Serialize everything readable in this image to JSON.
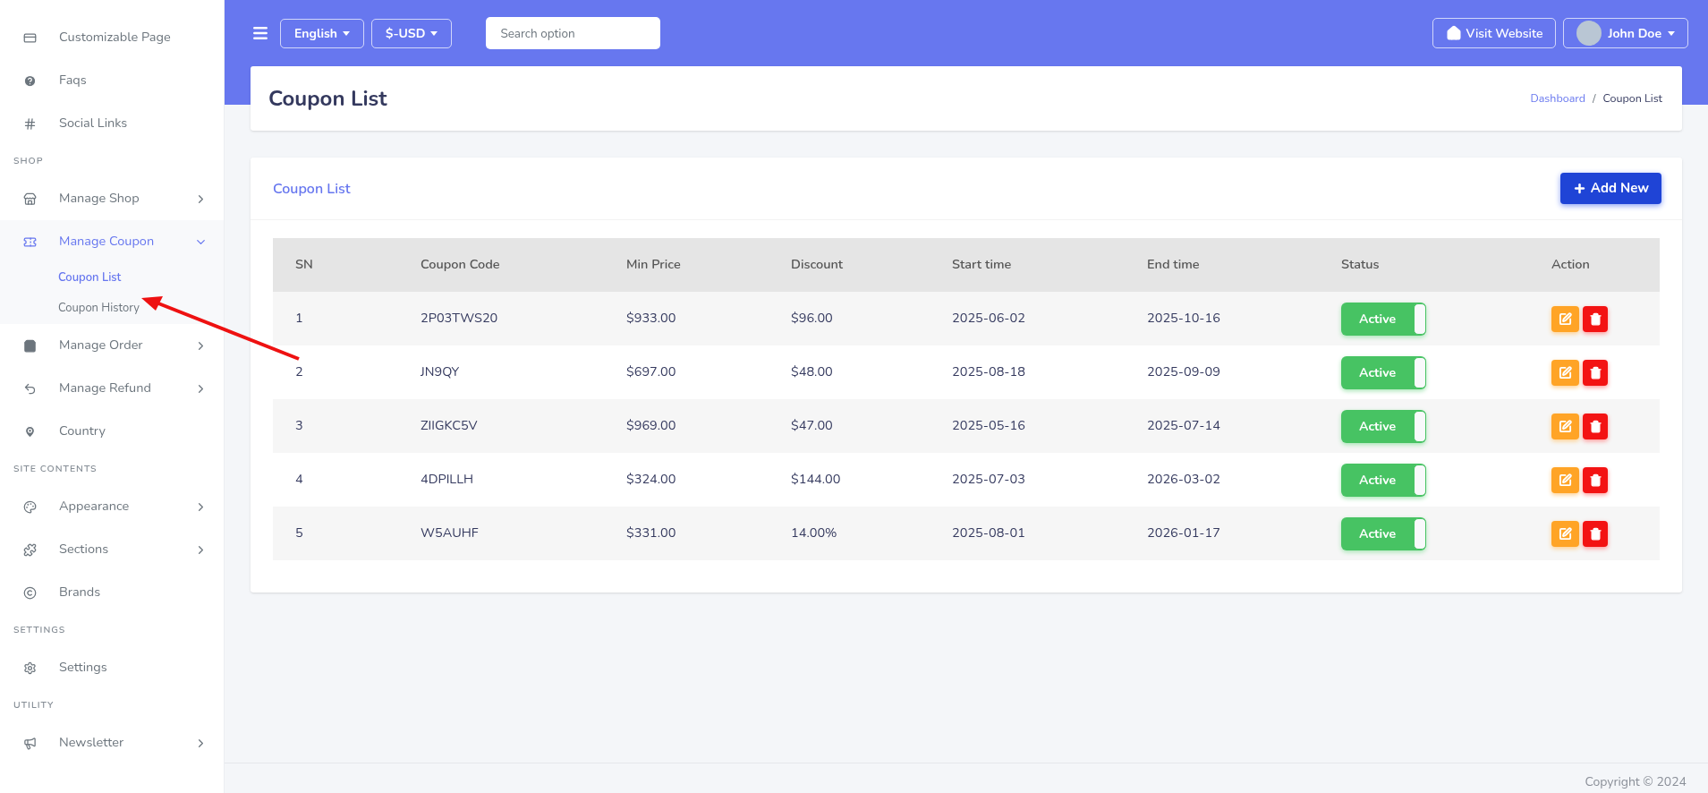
{
  "sidebar": {
    "groups": [
      {
        "items": [
          {
            "label": "Customizable Page",
            "arrow": false,
            "selected": false
          },
          {
            "label": "Faqs",
            "arrow": false,
            "selected": false
          },
          {
            "label": "Social Links",
            "arrow": false,
            "selected": false
          }
        ]
      },
      {
        "label": "SHOP",
        "items": [
          {
            "label": "Manage Shop",
            "arrow": true,
            "expanded": false,
            "selected": false
          },
          {
            "label": "Manage Coupon",
            "arrow": true,
            "expanded": true,
            "selected": true,
            "children": [
              {
                "label": "Coupon List",
                "selected": true
              },
              {
                "label": "Coupon History",
                "selected": false
              }
            ]
          },
          {
            "label": "Manage Order",
            "arrow": true,
            "expanded": false,
            "selected": false
          },
          {
            "label": "Manage Refund",
            "arrow": true,
            "expanded": false,
            "selected": false
          },
          {
            "label": "Country",
            "arrow": false,
            "selected": false
          }
        ]
      },
      {
        "label": "SITE CONTENTS",
        "items": [
          {
            "label": "Appearance",
            "arrow": true,
            "expanded": false,
            "selected": false
          },
          {
            "label": "Sections",
            "arrow": true,
            "expanded": false,
            "selected": false
          },
          {
            "label": "Brands",
            "arrow": false,
            "selected": false
          }
        ]
      },
      {
        "label": "SETTINGS",
        "items": [
          {
            "label": "Settings",
            "arrow": false,
            "selected": false
          }
        ]
      },
      {
        "label": "UTILITY",
        "items": [
          {
            "label": "Newsletter",
            "arrow": true,
            "expanded": false,
            "selected": false
          }
        ]
      }
    ]
  },
  "topbar": {
    "language": "English",
    "currency": "$-USD",
    "search": {
      "placeholder": "Search option"
    },
    "visit_button": "Visit Website",
    "user": "John Doe"
  },
  "page_header": {
    "title": "Coupon List",
    "breadcrumb": {
      "link": "Dashboard",
      "separator": "/",
      "current": "Coupon List"
    }
  },
  "card": {
    "title": "Coupon List",
    "add_button": "Add New"
  },
  "table": {
    "columns": [
      "SN",
      "Coupon Code",
      "Min Price",
      "Discount",
      "Start time",
      "End time",
      "Status",
      "Action"
    ],
    "rows": [
      {
        "sn": "1",
        "code": "2P03TWS20",
        "min_price": "$933.00",
        "discount": "$96.00",
        "start": "2025-06-02",
        "end": "2025-10-16",
        "status": "Active",
        "on": true
      },
      {
        "sn": "2",
        "code": "JN9QY",
        "min_price": "$697.00",
        "discount": "$48.00",
        "start": "2025-08-18",
        "end": "2025-09-09",
        "status": "Active",
        "on": true
      },
      {
        "sn": "3",
        "code": "ZIIGKC5V",
        "min_price": "$969.00",
        "discount": "$47.00",
        "start": "2025-05-16",
        "end": "2025-07-14",
        "status": "Active",
        "on": true
      },
      {
        "sn": "4",
        "code": "4DPILLH",
        "min_price": "$324.00",
        "discount": "$144.00",
        "start": "2025-07-03",
        "end": "2026-03-02",
        "status": "Active",
        "on": true
      },
      {
        "sn": "5",
        "code": "W5AUHF",
        "min_price": "$331.00",
        "discount": "14.00%",
        "start": "2025-08-01",
        "end": "2026-01-17",
        "status": "Active",
        "on": true
      }
    ]
  },
  "footer": {
    "copyright": "Copyright © 2024"
  }
}
